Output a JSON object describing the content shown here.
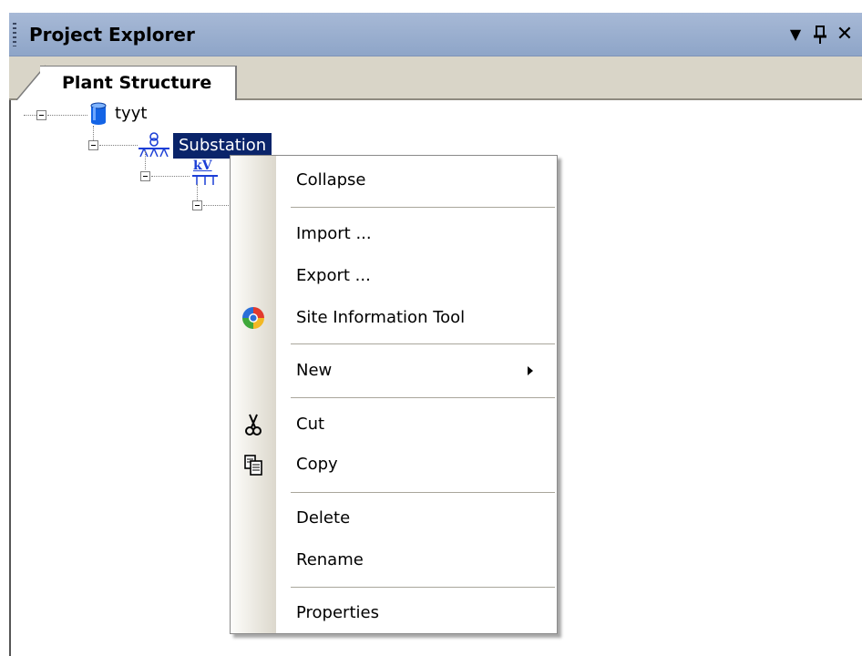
{
  "panel": {
    "title": "Project Explorer",
    "buttons": {
      "dropdown": "▼",
      "pin": "Т",
      "close": "✕"
    }
  },
  "tabs": [
    {
      "label": "Plant Structure",
      "active": true
    }
  ],
  "tree": {
    "root": {
      "label": "tyyt",
      "icon": "database-icon"
    },
    "substation": {
      "label": "Substation",
      "icon": "substation-icon",
      "selected": true
    },
    "voltage": {
      "label": "kV",
      "icon": "voltage-level-icon"
    }
  },
  "context_menu": {
    "items": [
      {
        "id": "collapse",
        "label": "Collapse"
      },
      {
        "id": "import",
        "label": "Import ..."
      },
      {
        "id": "export",
        "label": "Export ..."
      },
      {
        "id": "site_info",
        "label": "Site Information Tool",
        "icon": "site-information-icon"
      },
      {
        "id": "new",
        "label": "New",
        "submenu": true
      },
      {
        "id": "cut",
        "label": "Cut",
        "icon": "scissors-icon"
      },
      {
        "id": "copy",
        "label": "Copy",
        "icon": "copy-icon"
      },
      {
        "id": "delete",
        "label": "Delete"
      },
      {
        "id": "rename",
        "label": "Rename"
      },
      {
        "id": "properties",
        "label": "Properties"
      }
    ]
  },
  "colors": {
    "title_bar": "#8ea5c8",
    "selection": "#0a246a",
    "tab_strip": "#d9d5c8",
    "menu_gutter": "#e6e3da"
  }
}
